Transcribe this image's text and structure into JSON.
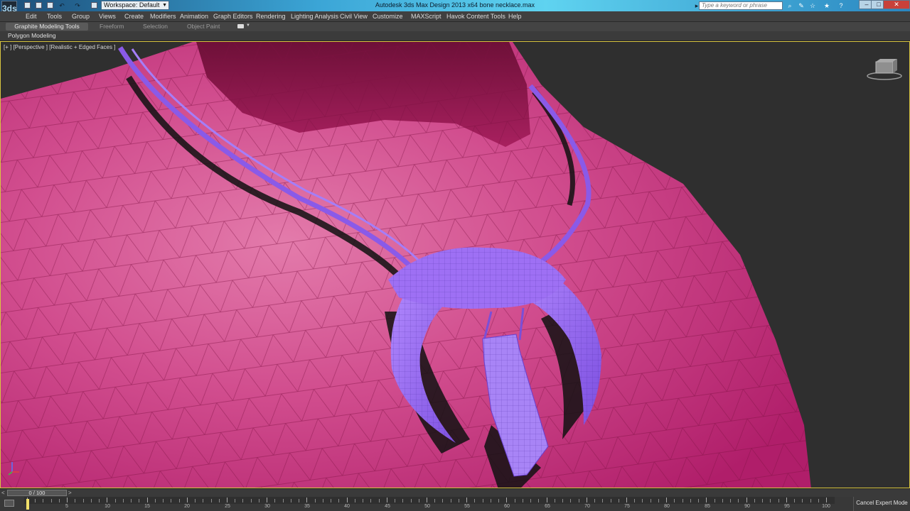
{
  "window": {
    "app_logo": "3ds",
    "workspace": "Workspace: Default",
    "title": "Autodesk 3ds Max Design 2013 x64      bone necklace.max",
    "search_placeholder": "Type a keyword or phrase",
    "minimize": "–",
    "maximize": "□",
    "close": "✕"
  },
  "menu": {
    "items": [
      "Edit",
      "Tools",
      "Group",
      "Views",
      "Create",
      "Modifiers",
      "Animation",
      "Graph Editors",
      "Rendering",
      "Lighting Analysis",
      "Civil View",
      "Customize",
      "MAXScript",
      "Havok Content Tools",
      "Help"
    ]
  },
  "ribbon": {
    "tabs": [
      "Graphite Modeling Tools",
      "Freeform",
      "Selection",
      "Object Paint"
    ],
    "active_tab": "Graphite Modeling Tools",
    "panel": "Polygon Modeling"
  },
  "viewport": {
    "label": "[+ ] [Perspective ] [Realistic + Edged Faces ]",
    "viewcube_icon": "viewcube-icon",
    "colors": {
      "body": "#c8307a",
      "necklace": "#9a6ef0",
      "background": "#2e2e2e",
      "active_border": "#d8c640"
    }
  },
  "timeslider": {
    "prev": "<",
    "frame_readout": "0 / 100",
    "next": ">",
    "current_frame": 0,
    "total_frames": 100
  },
  "trackbar": {
    "labels": [
      "5",
      "10",
      "15",
      "20",
      "25",
      "30",
      "35",
      "40",
      "45",
      "50",
      "55",
      "60",
      "65",
      "70",
      "75",
      "80",
      "85",
      "90",
      "95",
      "100"
    ]
  },
  "status": {
    "cancel_expert": "Cancel Expert Mode"
  }
}
